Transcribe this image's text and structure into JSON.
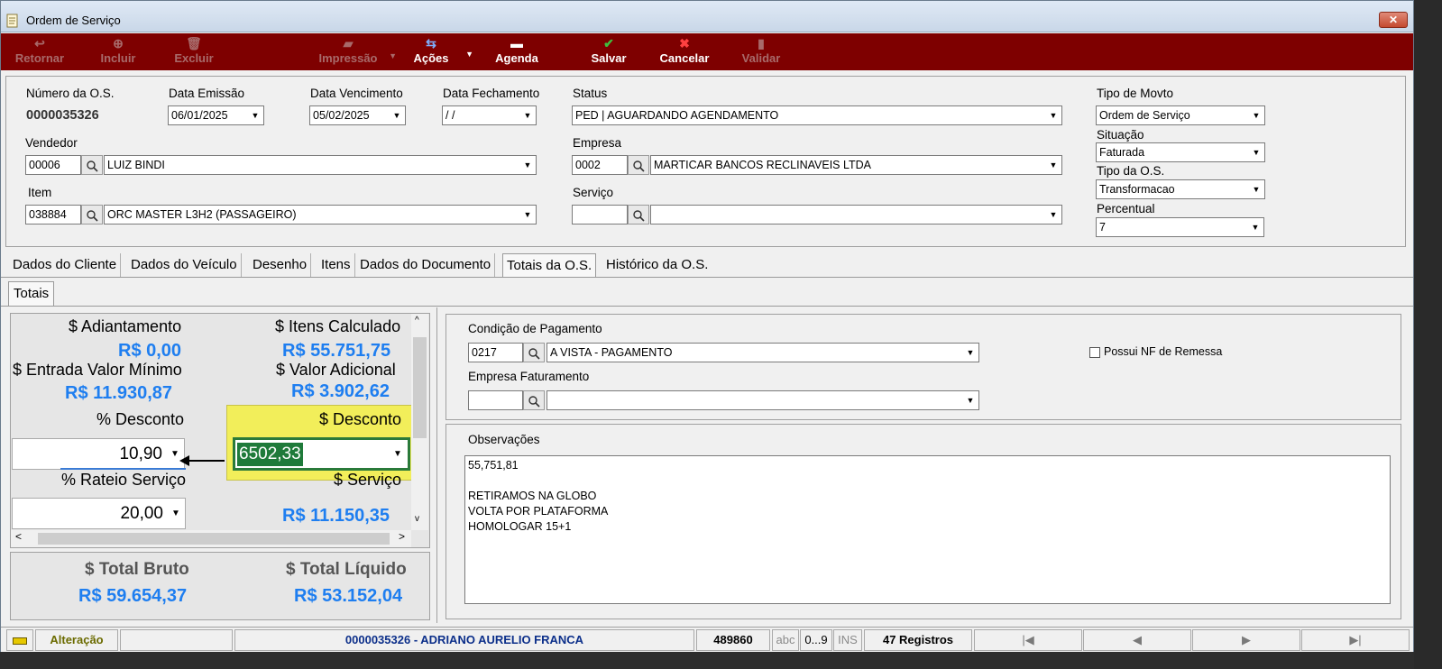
{
  "window": {
    "title": "Ordem de Serviço",
    "close_label": "✕"
  },
  "toolbar": {
    "retornar": "Retornar",
    "incluir": "Incluir",
    "excluir": "Excluir",
    "impressao": "Impressão",
    "acoes": "Ações",
    "agenda": "Agenda",
    "salvar": "Salvar",
    "cancelar": "Cancelar",
    "validar": "Validar"
  },
  "header": {
    "numero_label": "Número da O.S.",
    "numero_value": "0000035326",
    "emissao_label": "Data Emissão",
    "emissao_value": "06/01/2025",
    "vencimento_label": "Data Vencimento",
    "vencimento_value": "05/02/2025",
    "fechamento_label": "Data Fechamento",
    "fechamento_value": " /  /",
    "status_label": "Status",
    "status_value": "PED | AGUARDANDO AGENDAMENTO",
    "tipo_movto_label": "Tipo de Movto",
    "tipo_movto_value": "Ordem de Serviço",
    "vendedor_label": "Vendedor",
    "vendedor_code": "00006",
    "vendedor_name": "LUIZ BINDI",
    "empresa_label": "Empresa",
    "empresa_code": "0002",
    "empresa_name": "MARTICAR BANCOS RECLINAVEIS LTDA",
    "situacao_label": "Situação",
    "situacao_value": "Faturada",
    "tipo_os_label": "Tipo da O.S.",
    "tipo_os_value": "Transformacao",
    "item_label": "Item",
    "item_code": "038884",
    "item_name": "ORC MASTER L3H2 (PASSAGEIRO)",
    "servico_label": "Serviço",
    "servico_code": "",
    "servico_name": "",
    "percentual_label": "Percentual",
    "percentual_value": "7"
  },
  "tabs": [
    "Dados do Cliente",
    "Dados do Veículo",
    "Desenho",
    "Itens",
    "Dados do Documento",
    "Totais da O.S.",
    "Histórico da O.S."
  ],
  "subtab": "Totais",
  "totais": {
    "adiantamento_label": "$ Adiantamento",
    "adiantamento_value": "R$ 0,00",
    "itens_calc_label": "$ Itens Calculado",
    "itens_calc_value": "R$ 55.751,75",
    "entrada_min_label": "$ Entrada Valor Mínimo",
    "entrada_min_value": "R$ 11.930,87",
    "valor_adic_label": "$ Valor Adicional",
    "valor_adic_value": "R$ 3.902,62",
    "pct_desconto_label": "% Desconto",
    "pct_desconto_value": "10,90",
    "desconto_label": "$ Desconto",
    "desconto_value": "6502,33",
    "rateio_label": "% Rateio Serviço",
    "rateio_value": "20,00",
    "servico_label": "$ Serviço",
    "servico_value": "R$ 11.150,35",
    "total_bruto_label": "$ Total Bruto",
    "total_bruto_value": "R$ 59.654,37",
    "total_liquido_label": "$ Total Líquido",
    "total_liquido_value": "R$ 53.152,04"
  },
  "pagamento": {
    "condicao_label": "Condição de Pagamento",
    "condicao_code": "0217",
    "condicao_name": "A VISTA - PAGAMENTO",
    "empresa_fat_label": "Empresa Faturamento",
    "empresa_fat_code": "",
    "empresa_fat_name": "",
    "nf_remessa_label": "Possui NF de Remessa"
  },
  "observacoes": {
    "label": "Observações",
    "lines": [
      "55,751,81",
      "",
      "RETIRAMOS NA GLOBO",
      "VOLTA POR PLATAFORMA",
      "HOMOLOGAR 15+1"
    ]
  },
  "status": {
    "mode": "Alteração",
    "record": "0000035326 - ADRIANO AURELIO FRANCA",
    "code": "489860",
    "abc": "abc",
    "num": "0...9",
    "ins": "INS",
    "registros": "47 Registros",
    "first": "|◀",
    "prev": "◀",
    "next": "▶",
    "last": "▶|"
  }
}
